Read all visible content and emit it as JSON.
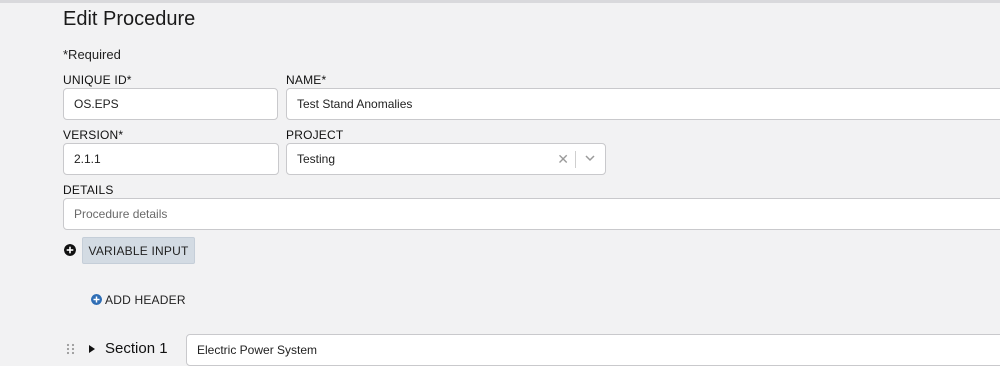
{
  "page": {
    "title": "Edit Procedure",
    "required_note": "*Required"
  },
  "form": {
    "unique_id": {
      "label": "UNIQUE ID*",
      "value": "OS.EPS"
    },
    "name": {
      "label": "NAME*",
      "value": "Test Stand Anomalies"
    },
    "version": {
      "label": "VERSION*",
      "value": "2.1.1"
    },
    "project": {
      "label": "PROJECT",
      "value": "Testing"
    },
    "details": {
      "label": "DETAILS",
      "placeholder": "Procedure details"
    }
  },
  "actions": {
    "variable_input": "VARIABLE INPUT",
    "add_header": "ADD HEADER"
  },
  "sections": [
    {
      "label": "Section 1",
      "title": "Electric Power System"
    }
  ],
  "icons": {
    "add_variable": "plus-circle-icon",
    "add_header": "plus-circle-icon",
    "clear": "clear-icon",
    "dropdown": "chevron-down-icon",
    "drag": "drag-handle-icon",
    "expand": "caret-right-icon"
  },
  "colors": {
    "background": "#f2f2f3",
    "button": "#d3dbe3",
    "add_header_icon": "#2f6eb5"
  }
}
